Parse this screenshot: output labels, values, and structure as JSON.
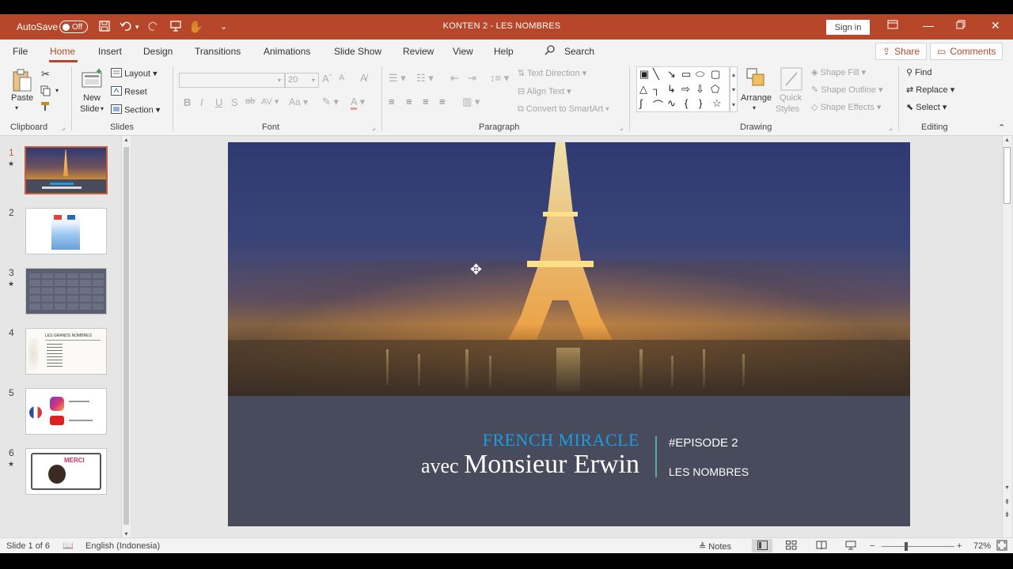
{
  "titlebar": {
    "autosave_label": "AutoSave",
    "autosave_state": "Off",
    "doc_title": "KONTEN 2 - LES NOMBRES",
    "signin_label": "Sign in"
  },
  "tabs": [
    {
      "label": "File"
    },
    {
      "label": "Home"
    },
    {
      "label": "Insert"
    },
    {
      "label": "Design"
    },
    {
      "label": "Transitions"
    },
    {
      "label": "Animations"
    },
    {
      "label": "Slide Show"
    },
    {
      "label": "Review"
    },
    {
      "label": "View"
    },
    {
      "label": "Help"
    }
  ],
  "search_label": "Search",
  "share_label": "Share",
  "comments_label": "Comments",
  "ribbon": {
    "clipboard": {
      "paste": "Paste",
      "label": "Clipboard"
    },
    "slides": {
      "new_slide_1": "New",
      "new_slide_2": "Slide",
      "layout": "Layout",
      "reset": "Reset",
      "section": "Section",
      "label": "Slides"
    },
    "font": {
      "font_size": "20",
      "label": "Font"
    },
    "paragraph": {
      "text_direction": "Text Direction",
      "align_text": "Align Text",
      "convert_smartart": "Convert to SmartArt",
      "label": "Paragraph"
    },
    "drawing": {
      "arrange": "Arrange",
      "quick_styles_1": "Quick",
      "quick_styles_2": "Styles",
      "shape_fill": "Shape Fill",
      "shape_outline": "Shape Outline",
      "shape_effects": "Shape Effects",
      "label": "Drawing"
    },
    "editing": {
      "find": "Find",
      "replace": "Replace",
      "select": "Select",
      "label": "Editing"
    }
  },
  "thumbnails": [
    {
      "number": "1",
      "star": true
    },
    {
      "number": "2",
      "star": false
    },
    {
      "number": "3",
      "star": true
    },
    {
      "number": "4",
      "star": false,
      "heading": "LES GRANDS NOMBRES"
    },
    {
      "number": "5",
      "star": false
    },
    {
      "number": "6",
      "star": true,
      "text": "MERCI"
    }
  ],
  "slide": {
    "title_line1": "FRENCH MIRACLE",
    "title_avec": "avec ",
    "title_name": "Monsieur Erwin",
    "episode": "#EPISODE 2",
    "subtitle": "LES NOMBRES"
  },
  "status": {
    "slide_count": "Slide 1 of 6",
    "language": "English (Indonesia)",
    "notes": "Notes",
    "zoom": "72%"
  },
  "colors": {
    "accent": "#b7472a",
    "slide_band": "#474b5c",
    "title_blue": "#1f9be0"
  }
}
